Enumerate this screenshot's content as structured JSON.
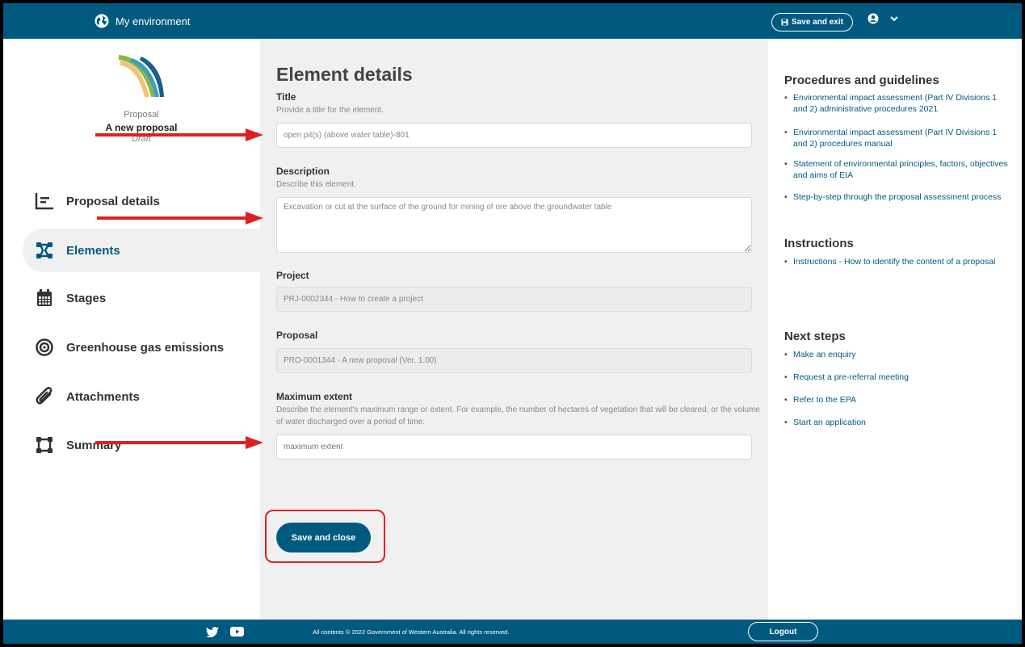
{
  "header": {
    "app_name": "My environment",
    "save_exit_label": "Save and exit"
  },
  "sidebar": {
    "proposal_caption": "Proposal",
    "proposal_name": "A new proposal",
    "proposal_status": "Draft",
    "items": [
      {
        "label": "Proposal details",
        "icon": "chart-icon",
        "active": false
      },
      {
        "label": "Elements",
        "icon": "elements-icon",
        "active": true
      },
      {
        "label": "Stages",
        "icon": "calendar-icon",
        "active": false
      },
      {
        "label": "Greenhouse gas emissions",
        "icon": "target-icon",
        "active": false
      },
      {
        "label": "Attachments",
        "icon": "paperclip-icon",
        "active": false
      },
      {
        "label": "Summary",
        "icon": "summary-icon",
        "active": false
      }
    ]
  },
  "main": {
    "title": "Element details",
    "fields": {
      "title": {
        "label": "Title",
        "hint": "Provide a title for the element.",
        "value": "open pit(s) (above water table)-801"
      },
      "description": {
        "label": "Description",
        "hint": "Describe this element.",
        "value": "Excavation or cut at the surface of the ground for mining of ore above the groundwater table"
      },
      "project": {
        "label": "Project",
        "value": "PRJ-0002344 - How to create a project"
      },
      "proposal": {
        "label": "Proposal",
        "value": "PRO-0001344 - A new proposal (Ver. 1.00)"
      },
      "max_extent": {
        "label": "Maximum extent",
        "hint": "Describe the element's maximum range or extent. For example, the number of hectares of vegetation that will be cleared, or the volume of water discharged over a period of time.",
        "placeholder": "maximum extent"
      }
    },
    "save_close_label": "Save and close"
  },
  "right_panel": {
    "procedures_heading": "Procedures and guidelines",
    "procedures": [
      "Environmental impact assessment (Part IV Divisions 1 and 2) administrative procedures 2021",
      "Environmental impact assessment (Part IV Divisions 1 and 2) procedures manual",
      "Statement of environmental principles, factors, objectives and aims of EIA",
      "Step-by-step through the proposal assessment process"
    ],
    "instructions_heading": "Instructions",
    "instructions": [
      "Instructions - How to identify the content of a proposal"
    ],
    "next_heading": "Next steps",
    "next_steps": [
      "Make an enquiry",
      "Request a pre-referral meeting",
      "Refer to the EPA",
      "Start an application"
    ]
  },
  "footer": {
    "copyright": "All contents © 2022 Government of Western Australia. All rights reserved.",
    "logout_label": "Logout"
  },
  "colors": {
    "brand": "#005a80",
    "annotation": "#e02020",
    "panel_bg": "#f0f0f0"
  }
}
